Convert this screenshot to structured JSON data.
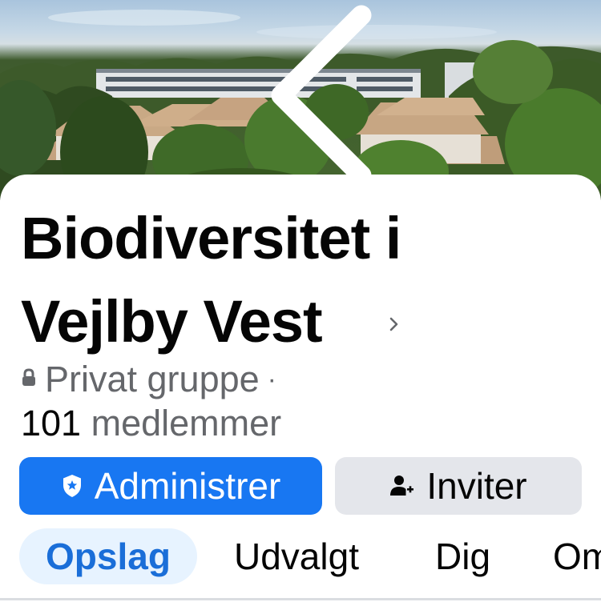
{
  "cover": {
    "alt": "Cover photo"
  },
  "topbar": {
    "back_icon": "chevron-left-icon",
    "search_icon": "search-icon",
    "badge_icon": "star-badge-icon"
  },
  "group": {
    "title": "Biodiversitet i Vejlby Vest",
    "privacy": "Privat gruppe",
    "privacy_separator": "·",
    "member_count": "101",
    "member_label": "medlemmer"
  },
  "actions": {
    "admin_label": "Administrer",
    "admin_icon": "shield-star-icon",
    "invite_label": "Inviter",
    "invite_icon": "add-person-icon"
  },
  "tabs": [
    {
      "label": "Opslag",
      "active": true
    },
    {
      "label": "Udvalgt",
      "active": false
    },
    {
      "label": "Dig",
      "active": false
    },
    {
      "label": "Om",
      "active": false
    }
  ],
  "colors": {
    "accent": "#1877f2",
    "active_tab_bg": "#e7f3ff",
    "active_tab_text": "#1a6ed8",
    "secondary_button": "#e4e6eb",
    "muted_text": "#65676b"
  }
}
